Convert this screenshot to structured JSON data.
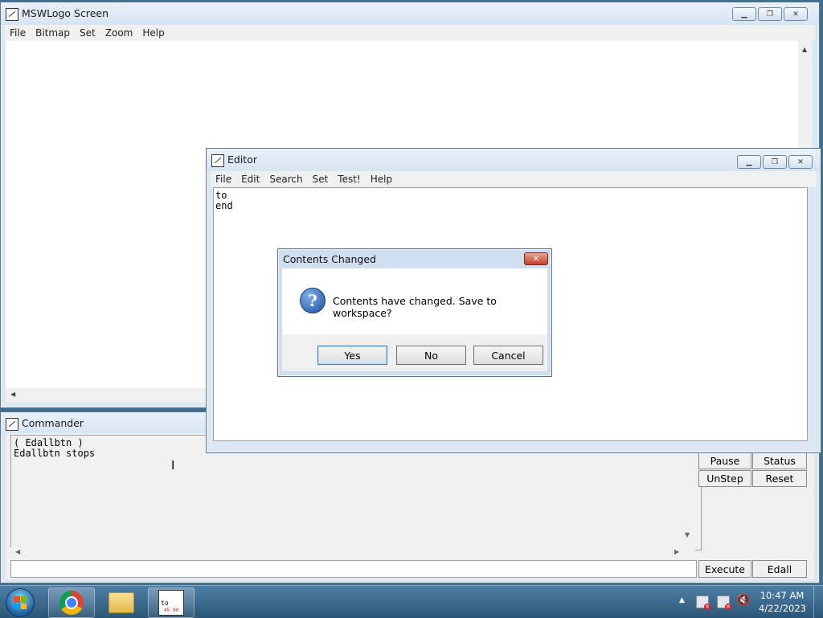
{
  "screen_window": {
    "title": "MSWLogo Screen",
    "menu": [
      "File",
      "Bitmap",
      "Set",
      "Zoom",
      "Help"
    ]
  },
  "editor_window": {
    "title": "Editor",
    "menu": [
      "File",
      "Edit",
      "Search",
      "Set",
      "Test!",
      "Help"
    ],
    "text": "to\nend"
  },
  "dialog": {
    "title": "Contents Changed",
    "message": "Contents have changed. Save to workspace?",
    "buttons": {
      "yes": "Yes",
      "no": "No",
      "cancel": "Cancel"
    }
  },
  "commander": {
    "title": "Commander",
    "output": "( Edallbtn )\nEdallbtn stops",
    "input_value": "",
    "buttons": {
      "pause": "Pause",
      "status": "Status",
      "unstep": "UnStep",
      "reset": "Reset",
      "execute": "Execute",
      "edall": "Edall"
    }
  },
  "taskbar": {
    "items": [
      "start-orb",
      "chrome",
      "file-explorer",
      "mswlogo"
    ],
    "logo_thumb_text": "to",
    "logo_thumb_sub": "45 90",
    "time": "10:47 AM",
    "date": "4/22/2023"
  }
}
